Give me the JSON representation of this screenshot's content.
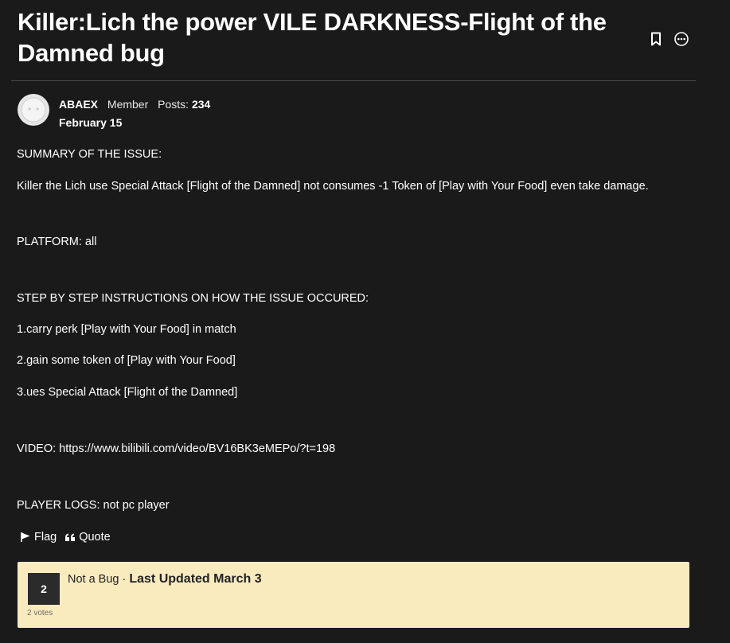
{
  "thread": {
    "title": "Killer:Lich the power VILE DARKNESS-Flight of the Damned bug"
  },
  "header": {
    "icons": [
      "bookmark-icon",
      "more-options-icon"
    ]
  },
  "post": {
    "author": {
      "name": "ABAEX",
      "role": "Member",
      "posts_label": "Posts:",
      "posts": "234"
    },
    "date": "February 15",
    "body": [
      "SUMMARY OF THE ISSUE:",
      "Killer the Lich use Special Attack [Flight of the Damned] not consumes -1 Token of [Play with Your Food] even take damage.",
      "PLATFORM: all",
      "STEP BY STEP INSTRUCTIONS ON HOW THE ISSUE OCCURED:",
      "1.carry perk [Play with Your Food] in match",
      "2.gain some token of [Play with Your Food]",
      "3.ues Special Attack [Flight of the Damned]",
      "VIDEO: https://www.bilibili.com/video/BV16BK3eMEPo/?t=198",
      "PLAYER LOGS: not pc player"
    ],
    "actions": {
      "flag": "Flag",
      "quote": "Quote"
    }
  },
  "status": {
    "votes": "2",
    "votes_label": "2 votes",
    "state": "Not a Bug",
    "separator": "·",
    "updated": "Last Updated March 3"
  },
  "colors": {
    "background": "#1a1a1b",
    "status_box": "#faebbf",
    "vote_box": "#2b2b2b"
  }
}
